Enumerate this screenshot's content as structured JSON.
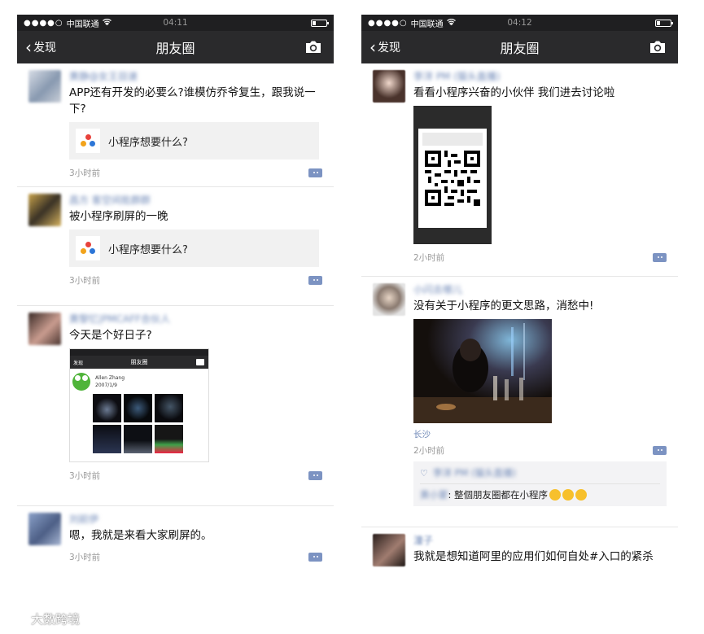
{
  "left_phone": {
    "status": {
      "signal": "●●●●○",
      "carrier": "中国联通",
      "time": "04:11"
    },
    "nav": {
      "back": "发现",
      "title": "朋友圈"
    },
    "posts": [
      {
        "name": "黄静@女王目速",
        "text": "APP还有开发的必要么?谁模仿乔爷复生，跟我说一下?",
        "link": "小程序想要什么?",
        "time": "3小时前"
      },
      {
        "name": "昌方 客空间批群群",
        "text": "被小程序刷屏的一晚",
        "link": "小程序想要什么?",
        "time": "3小时前"
      },
      {
        "name": "黄黎忆|PMCAFF合伙人",
        "text": "今天是个好日子?",
        "shot_back": "发现",
        "shot_title": "朋友圈",
        "shot_author": "Allen Zhang",
        "shot_date": "2007/1/9",
        "time": "3小时前"
      },
      {
        "name": "刘前伊",
        "text": "嗯，我就是来看大家刷屏的。",
        "time": "3小时前"
      }
    ]
  },
  "right_phone": {
    "status": {
      "signal": "●●●●○",
      "carrier": "中国联通",
      "time": "04:12"
    },
    "nav": {
      "back": "发现",
      "title": "朋友圈"
    },
    "posts": [
      {
        "name": "李洋 PM (猫头直播)",
        "text": "看看小程序兴奋的小伙伴 我们进去讨论啦",
        "time": "2小时前"
      },
      {
        "name": "小闪去哪儿",
        "text": "没有关于小程序的更文思路，消愁中!",
        "location": "长沙",
        "time": "2小时前",
        "like_names": "李洋 PM (猫头直播)",
        "comment_name": "黄小蒙",
        "comment_text": ": 整個朋友圈都在小程序"
      },
      {
        "name": "潼子",
        "text": "我就是想知道阿里的应用们如何自处#入口的紧杀"
      }
    ]
  },
  "watermark": {
    "text": "大数跨境"
  },
  "colors": {
    "nav_bg": "#2a2a2c",
    "status_bg": "#1f1f21",
    "link_blue": "#6c86b6",
    "card_bg": "#f1f1f1"
  }
}
